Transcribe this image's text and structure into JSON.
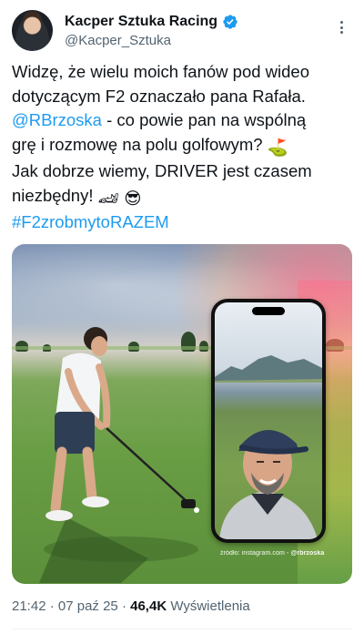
{
  "author": {
    "display_name": "Kacper Sztuka Racing",
    "handle": "@Kacper_Sztuka",
    "verified": true
  },
  "tweet": {
    "lines": [
      "Widzę, że wielu moich fanów pod wideo",
      "dotyczącym F2 oznaczało pana Rafała.",
      "- co powie pan na wspólną",
      "grę i rozmowę na polu golfowym?",
      "Jak dobrze wiemy, DRIVER jest czasem",
      "niezbędny!"
    ],
    "mention": "@RBrzoska",
    "hashtag": "#F2zrobmytoRAZEM",
    "emoji_golf": "⛳",
    "emoji_car": "🏎",
    "emoji_sunglasses": "😎"
  },
  "media": {
    "credit_prefix": "źródło: instagram.com - ",
    "credit_handle": "@rbrzoska"
  },
  "meta": {
    "time": "21:42",
    "date": "07 paź 25",
    "views_count": "46,4K",
    "views_label": "Wyświetlenia",
    "separator": "·"
  },
  "icons": {
    "verified": "verified-badge-icon",
    "more": "more-options-icon"
  },
  "colors": {
    "link": "#1d9bf0",
    "text": "#0f1419",
    "secondary": "#536471"
  }
}
